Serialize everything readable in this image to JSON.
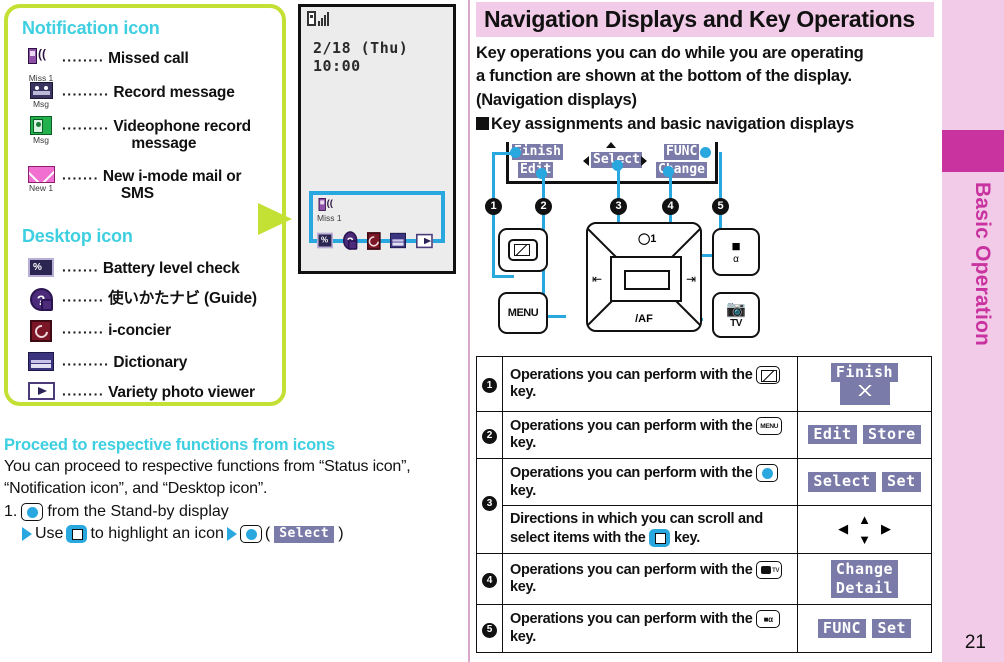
{
  "left_panel": {
    "notification_heading": "Notification icon",
    "notification_items": [
      {
        "icon": "missed-call-icon",
        "sub": "Miss 1",
        "dots": "········",
        "label": "Missed call"
      },
      {
        "icon": "record-message-icon",
        "sub": "Msg",
        "dots": "·········",
        "label": "Record message"
      },
      {
        "icon": "videophone-record-icon",
        "sub": "Msg",
        "dots": "·········",
        "label": "Videophone record",
        "label_cont": "message"
      },
      {
        "icon": "new-mail-icon",
        "sub": "New 1",
        "dots": "·······",
        "label": "New i-mode mail or",
        "label_cont": "SMS"
      }
    ],
    "desktop_heading": "Desktop icon",
    "desktop_items": [
      {
        "icon": "battery-level-icon",
        "dots": "·······",
        "label": "Battery level check"
      },
      {
        "icon": "guide-icon",
        "dots": "········",
        "label": "使いかたナビ (Guide)"
      },
      {
        "icon": "i-concier-icon",
        "dots": "········",
        "label": "i-concier"
      },
      {
        "icon": "dictionary-icon",
        "dots": "·········",
        "label": "Dictionary"
      },
      {
        "icon": "photo-viewer-icon",
        "dots": "········",
        "label": "Variety photo viewer"
      }
    ]
  },
  "phone_mockup": {
    "clock": "2/18 (Thu) 10:00",
    "notification_sub": "Miss 1",
    "highlight_color": "#29a8e0"
  },
  "bottom_left": {
    "heading": "Proceed to respective functions from icons",
    "paragraph": "You can proceed to respective functions from “Status icon”, “Notification icon”, and “Desktop icon”.",
    "step_number": "1.",
    "step_text": "from the Stand-by display",
    "sub_use": "Use",
    "sub_mid": "to highlight an icon",
    "sub_open": "(",
    "sub_chip": "Select",
    "sub_close": ")"
  },
  "right_panel": {
    "title": "Navigation Displays and Key Operations",
    "intro_line1": "Key operations you can do while you are operating",
    "intro_line2": "a function are shown at the bottom of the display.",
    "intro_line3": "(Navigation displays)",
    "subhead": "Key assignments and basic navigation displays",
    "diagram": {
      "nav_finish": "Finish",
      "nav_edit": "Edit",
      "nav_select": "Select",
      "nav_func": "FUNC",
      "nav_change": "Change",
      "callouts": [
        "1",
        "2",
        "3",
        "4",
        "5"
      ],
      "key_menu": "MENU",
      "key_af": "/AF",
      "key_tv": "TV"
    },
    "table": {
      "rows": [
        {
          "num": "1",
          "desc_pre": "Operations you can perform with the",
          "key_icon": "mail-key-icon",
          "desc_post": "key.",
          "nav": [
            "Finish"
          ],
          "nav_envelope": true
        },
        {
          "num": "2",
          "desc_pre": "Operations you can perform with the",
          "key_icon": "menu-key-icon",
          "desc_post": "key.",
          "nav": [
            "Edit",
            "Store"
          ],
          "nav_envelope": false
        },
        {
          "num": "3",
          "desc_pre": "Operations you can perform with the",
          "key_icon": "ok-key-icon",
          "desc_post": "key.",
          "nav": [
            "Select",
            "Set"
          ],
          "nav_envelope": false
        },
        {
          "num": "",
          "desc_pre": "Directions in which you can scroll and select items with the",
          "key_icon": "dpad-key-icon",
          "desc_post": "key.",
          "nav": [],
          "nav_arrows": true
        },
        {
          "num": "4",
          "desc_pre": "Operations you can perform with the",
          "key_icon": "camera-key-icon",
          "desc_post": "key.",
          "nav": [
            "Change",
            "Detail"
          ],
          "nav_envelope": false
        },
        {
          "num": "5",
          "desc_pre": "Operations you can perform with the",
          "key_icon": "func-key-icon",
          "desc_post": "key.",
          "nav": [
            "FUNC",
            "Set"
          ],
          "nav_envelope": false
        }
      ]
    }
  },
  "sidebar": {
    "label": "Basic Operation",
    "accent": "#c9339f",
    "background": "#f2cbe8"
  },
  "page_number": "21"
}
